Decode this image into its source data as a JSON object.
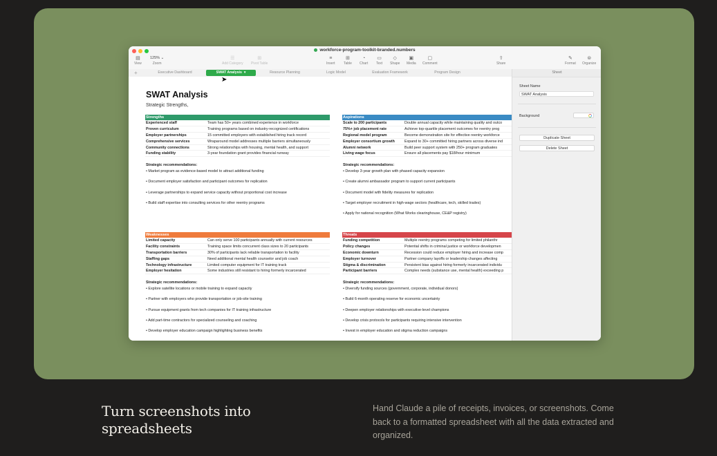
{
  "window": {
    "file_name": "workforce-program-toolkit-branded.numbers",
    "toolbar": {
      "view": "View",
      "zoom_value": "125% ⌄",
      "zoom": "Zoom",
      "add_category": "Add Category",
      "pivot_table": "Pivot Table",
      "insert": "Insert",
      "table": "Table",
      "chart": "Chart",
      "text": "Text",
      "shape": "Shape",
      "media": "Media",
      "comment": "Comment",
      "share": "Share",
      "format": "Format",
      "organize": "Organize"
    },
    "tabs": [
      {
        "label": "Executive Dashboard"
      },
      {
        "label": "SWAT Analysis"
      },
      {
        "label": "Resource Planning"
      },
      {
        "label": "Logic Model"
      },
      {
        "label": "Evaluation Framework"
      },
      {
        "label": "Program Design"
      }
    ],
    "sidebar": {
      "header": "Sheet",
      "sheet_name_label": "Sheet Name",
      "sheet_name_value": "SWAT Analysis",
      "background_label": "Background",
      "duplicate_button": "Duplicate Sheet",
      "delete_button": "Delete Sheet"
    },
    "sheet": {
      "title": "SWAT Analysis",
      "subtitle": "Strategic Strengths,",
      "colors": {
        "strengths": "#2e9a6a",
        "aspirations": "#3a8bc4",
        "weaknesses": "#ef7b3c",
        "threats": "#d6454a"
      },
      "strengths": {
        "header": "Strengths",
        "rows": [
          {
            "k": "Experienced staff",
            "v": "Team has 50+ years combined experience in workforce"
          },
          {
            "k": "Proven curriculum",
            "v": "Training programs based on industry-recognized certifications"
          },
          {
            "k": "Employer partnerships",
            "v": "15 committed employers with established hiring track record"
          },
          {
            "k": "Comprehensive services",
            "v": "Wraparound model addresses multiple barriers simultaneously"
          },
          {
            "k": "Community connections",
            "v": "Strong relationships with housing, mental health, and support"
          },
          {
            "k": "Funding stability",
            "v": "3-year foundation grant provides financial runway"
          }
        ],
        "recs_title": "Strategic recommendations:",
        "recs": [
          "• Market program as evidence-based model to attract additional funding",
          "• Document employer satisfaction and participant outcomes for replication",
          "• Leverage partnerships to expand service capacity without proportional cost increase",
          "• Build staff expertise into consulting services for other reentry programs"
        ]
      },
      "aspirations": {
        "header": "Aspirations",
        "rows": [
          {
            "k": "Scale to 200 participants",
            "v": "Double annual capacity while maintaining quality and outco"
          },
          {
            "k": "75%+ job placement rate",
            "v": "Achieve top-quartile placement outcomes for reentry prog"
          },
          {
            "k": "Regional model program",
            "v": "Become demonstration site for effective reentry workforce"
          },
          {
            "k": "Employer consortium growth",
            "v": "Expand to 30+ committed hiring partners across diverse ind"
          },
          {
            "k": "Alumni network",
            "v": "Build peer support system with 250+ program graduates"
          },
          {
            "k": "Living wage focus",
            "v": "Ensure all placements pay $18/hour minimum"
          }
        ],
        "recs_title": "Strategic recommendations:",
        "recs": [
          "• Develop 3-year growth plan with phased capacity expansion",
          "• Create alumni ambassador program to support current participants",
          "• Document model with fidelity measures for replication",
          "• Target employer recruitment in high-wage sectors (healthcare, tech, skilled trades)",
          "• Apply for national recognition (What Works clearinghouse, CE&P registry)"
        ]
      },
      "weaknesses": {
        "header": "Weaknesses",
        "rows": [
          {
            "k": "Limited capacity",
            "v": "Can only serve 100 participants annually with current resources"
          },
          {
            "k": "Facility constraints",
            "v": "Training space limits concurrent class sizes to 20 participants"
          },
          {
            "k": "Transportation barriers",
            "v": "30% of participants lack reliable transportation to facility"
          },
          {
            "k": "Staffing gaps",
            "v": "Need additional mental health counselor and job coach"
          },
          {
            "k": "Technology infrastructure",
            "v": "Limited computer equipment for IT training track"
          },
          {
            "k": "Employer hesitation",
            "v": "Some industries still resistant to hiring formerly incarcerated"
          }
        ],
        "recs_title": "Strategic recommendations:",
        "recs": [
          "• Explore satellite locations or mobile training to expand capacity",
          "• Partner with employers who provide transportation or job-site training",
          "• Pursue equipment grants from tech companies for IT training infrastructure",
          "• Add part-time contractors for specialized counseling and coaching",
          "• Develop employer education campaign highlighting business benefits"
        ]
      },
      "threats": {
        "header": "Threats",
        "rows": [
          {
            "k": "Funding competition",
            "v": "Multiple reentry programs competing for limited philanthr"
          },
          {
            "k": "Policy changes",
            "v": "Potential shifts in criminal justice or workforce developmen"
          },
          {
            "k": "Economic downturn",
            "v": "Recession could reduce employer hiring and increase comp"
          },
          {
            "k": "Employer turnover",
            "v": "Partner company layoffs or leadership changes affecting"
          },
          {
            "k": "Stigma & discrimination",
            "v": "Persistent bias against hiring formerly incarcerated individu"
          },
          {
            "k": "Participant barriers",
            "v": "Complex needs (substance use, mental health) exceeding p"
          }
        ],
        "recs_title": "Strategic recommendations:",
        "recs": [
          "• Diversify funding sources (government, corporate, individual donors)",
          "• Build 6-month operating reserve for economic uncertainty",
          "• Deepen employer relationships with executive-level champions",
          "• Develop crisis protocols for participants requiring intensive intervention",
          "• Invest in employer education and stigma reduction campaigns"
        ]
      }
    }
  },
  "footer": {
    "heading": "Turn screenshots into spreadsheets",
    "description": "Hand Claude a pile of receipts, invoices, or screenshots. Come back to a formatted spreadsheet with all the data extracted and organized."
  }
}
